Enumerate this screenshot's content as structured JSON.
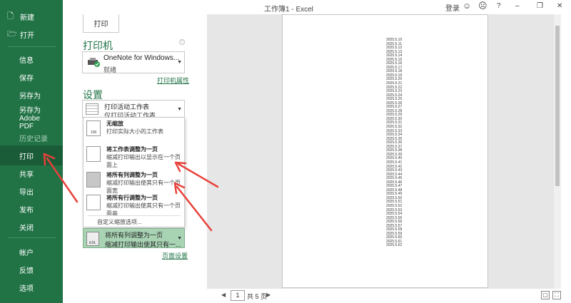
{
  "window": {
    "title": "工作簿1 - Excel",
    "signin": "登录",
    "help": "?",
    "smiley": "☺",
    "frown": "☹",
    "minimize": "–",
    "restore": "❐",
    "close": "✕"
  },
  "nav": {
    "new": "新建",
    "open": "打开",
    "info": "信息",
    "save": "保存",
    "save_as": "另存为",
    "save_adobe_1": "另存为 Adobe",
    "save_adobe_2": "PDF",
    "history": "历史记录",
    "print": "打印",
    "share": "共享",
    "export": "导出",
    "publish": "发布",
    "close": "关闭",
    "account": "帐户",
    "feedback": "反馈",
    "options": "选项"
  },
  "panel": {
    "print_button": "打印",
    "printer_heading": "打印机",
    "printer_name": "OneNote for Windows...",
    "printer_status": "就绪",
    "printer_properties": "打印机属性",
    "settings_heading": "设置",
    "active_sheets_title": "打印活动工作表",
    "active_sheets_desc": "仅打印活动工作表",
    "page_setup": "页面设置"
  },
  "scaling_menu": {
    "items": [
      {
        "title": "无缩放",
        "desc": "打印实际大小的工作表"
      },
      {
        "title": "将工作表调整为一页",
        "desc": "缩减打印输出以显示在一个页面上"
      },
      {
        "title": "将所有列调整为一页",
        "desc": "缩减打印输出使其只有一个页面宽"
      },
      {
        "title": "将所有行调整为一页",
        "desc": "缩减打印输出使其只有一个页面高"
      }
    ],
    "custom": "自定义缩放选项...",
    "icon_100": "100"
  },
  "selected_scaling": {
    "title": "将所有列调整为一页",
    "desc": "缩减打印输出使其只有一...",
    "icon_text": "EDL"
  },
  "preview": {
    "dates": [
      "2025.5.10",
      "2025.5.11",
      "2025.5.12",
      "2025.5.13",
      "2025.5.14",
      "2025.5.15",
      "2025.5.16",
      "2025.5.17",
      "2025.5.18",
      "2025.5.19",
      "2025.5.20",
      "2025.5.21",
      "2025.5.22",
      "2025.5.23",
      "2025.5.24",
      "2025.5.25",
      "2025.5.26",
      "2025.5.27",
      "2025.5.28",
      "2025.5.29",
      "2025.5.30",
      "2025.5.31",
      "2025.5.32",
      "2025.5.33",
      "2025.5.34",
      "2025.5.35",
      "2025.5.36",
      "2025.5.37",
      "2025.5.38",
      "2025.5.39",
      "2025.5.40",
      "2025.5.41",
      "2025.5.42",
      "2025.5.43",
      "2025.5.44",
      "2025.5.45",
      "2025.5.46",
      "2025.5.47",
      "2025.5.48",
      "2025.5.49",
      "2025.5.50",
      "2025.5.51",
      "2025.5.52",
      "2025.5.53",
      "2025.5.54",
      "2025.5.55",
      "2025.5.56",
      "2025.5.57",
      "2025.5.58",
      "2025.5.59",
      "2025.5.60",
      "2025.5.61",
      "2025.5.62"
    ]
  },
  "pager": {
    "current": "1",
    "total": "共 5 页",
    "prev": "◀",
    "next": "▶"
  },
  "colors": {
    "accent": "#217346",
    "arrow": "#e8413a"
  }
}
